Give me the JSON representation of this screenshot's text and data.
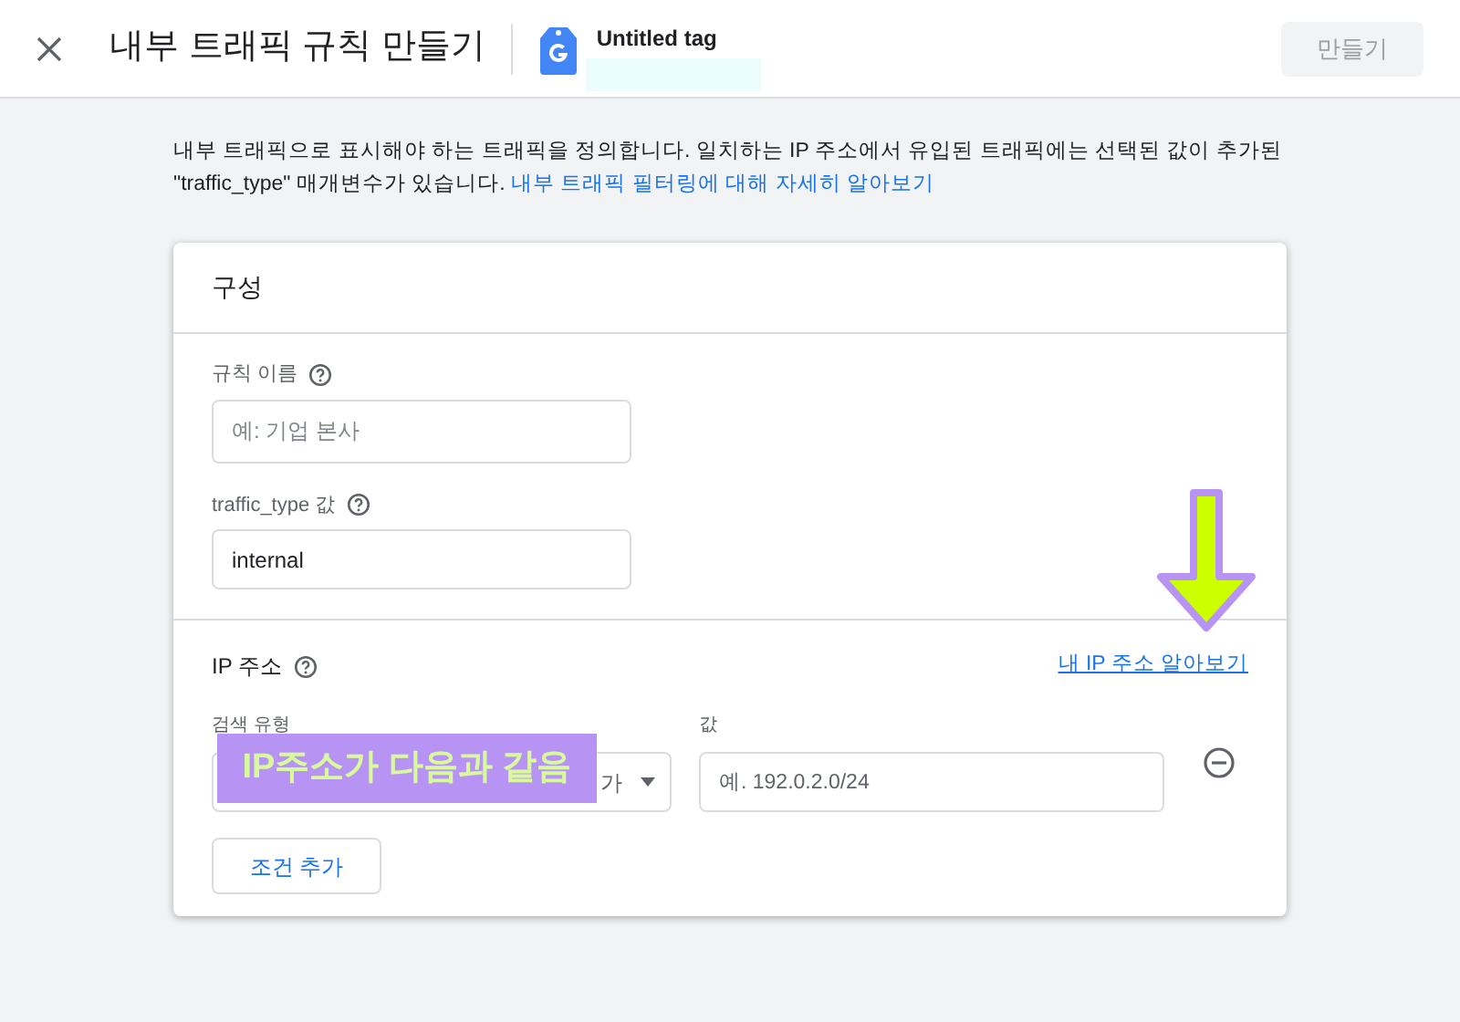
{
  "header": {
    "title": "내부 트래픽 규칙 만들기",
    "tag_name": "Untitled tag",
    "create_button": {
      "label": "만들기",
      "disabled": true
    }
  },
  "intro": {
    "text": "내부 트래픽으로 표시해야 하는 트래픽을 정의합니다. 일치하는 IP 주소에서 유입된 트래픽에는 선택된 값이 추가된 \"traffic_type\" 매개변수가 있습니다.",
    "link": "내부 트래픽 필터링에 대해 자세히 알아보기"
  },
  "card": {
    "title": "구성",
    "rule_name": {
      "label": "규칙 이름",
      "placeholder": "예: 기업 본사"
    },
    "traffic_type": {
      "label": "traffic_type 값",
      "value": "internal"
    },
    "ip": {
      "label": "IP 주소",
      "link": "내 IP 주소 알아보기",
      "match_label": "검색 유형",
      "match_value": "가",
      "value_label": "값",
      "value_placeholder": "예. 192.0.2.0/24"
    },
    "add_button": "조건 추가"
  },
  "annotation": {
    "text": "IP주소가 다음과 같음"
  }
}
